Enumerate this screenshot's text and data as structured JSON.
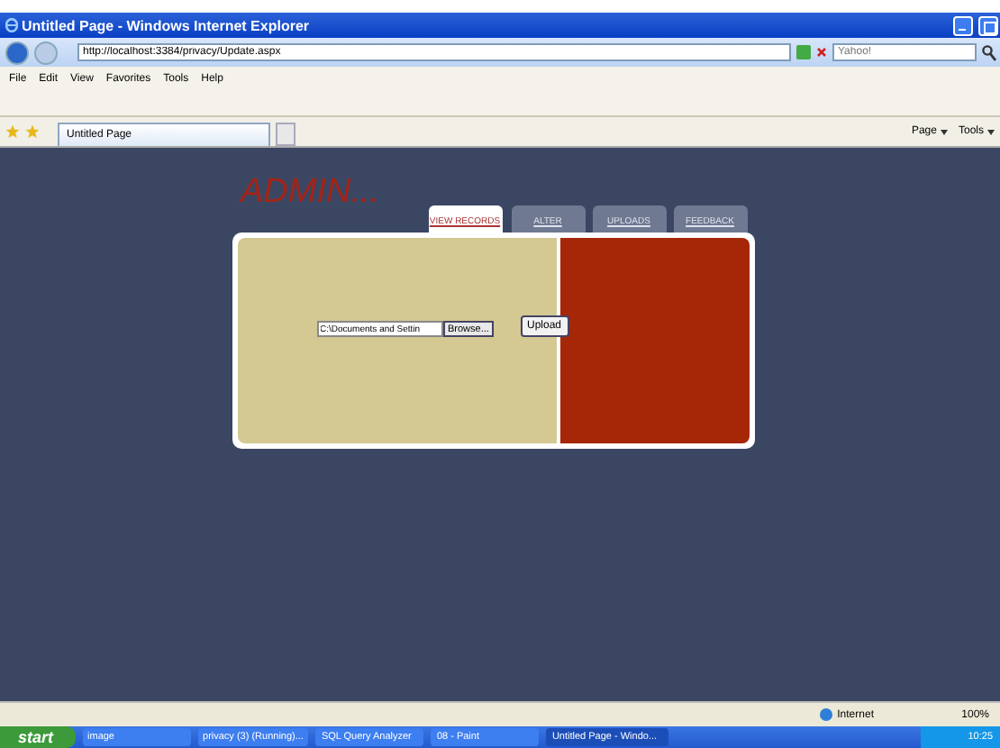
{
  "window": {
    "title": "Untitled Page - Windows Internet Explorer"
  },
  "address_bar": {
    "value": "http://localhost:3384/privacy/Update.aspx"
  },
  "search": {
    "placeholder": "Yahoo!"
  },
  "menu": [
    "File",
    "Edit",
    "View",
    "Favorites",
    "Tools",
    "Help"
  ],
  "browser_tabs": [
    {
      "label": "Untitled Page",
      "selected": true
    }
  ],
  "command_bar": [
    "Page",
    "Tools"
  ],
  "page": {
    "heading": "ADMIN...",
    "tabs": [
      {
        "label": "VIEW RECORDS",
        "selected": true
      },
      {
        "label": "ALTER",
        "selected": false
      },
      {
        "label": "UPLOADS",
        "selected": false
      },
      {
        "label": "FEEDBACK",
        "selected": false
      }
    ],
    "file_field": {
      "value": "C:\\Documents and Settin"
    },
    "browse_button": "Browse...",
    "upload_button": "Upload"
  },
  "status_bar": {
    "zone": "Internet",
    "zoom": "100%"
  },
  "taskbar": {
    "start": "start",
    "items": [
      {
        "label": "image",
        "selected": false
      },
      {
        "label": "privacy (3) (Running)...",
        "selected": false
      },
      {
        "label": "SQL Query Analyzer",
        "selected": false
      },
      {
        "label": "08 - Paint",
        "selected": false
      },
      {
        "label": "Untitled Page - Windo...",
        "selected": true
      }
    ],
    "clock": "10:25"
  }
}
